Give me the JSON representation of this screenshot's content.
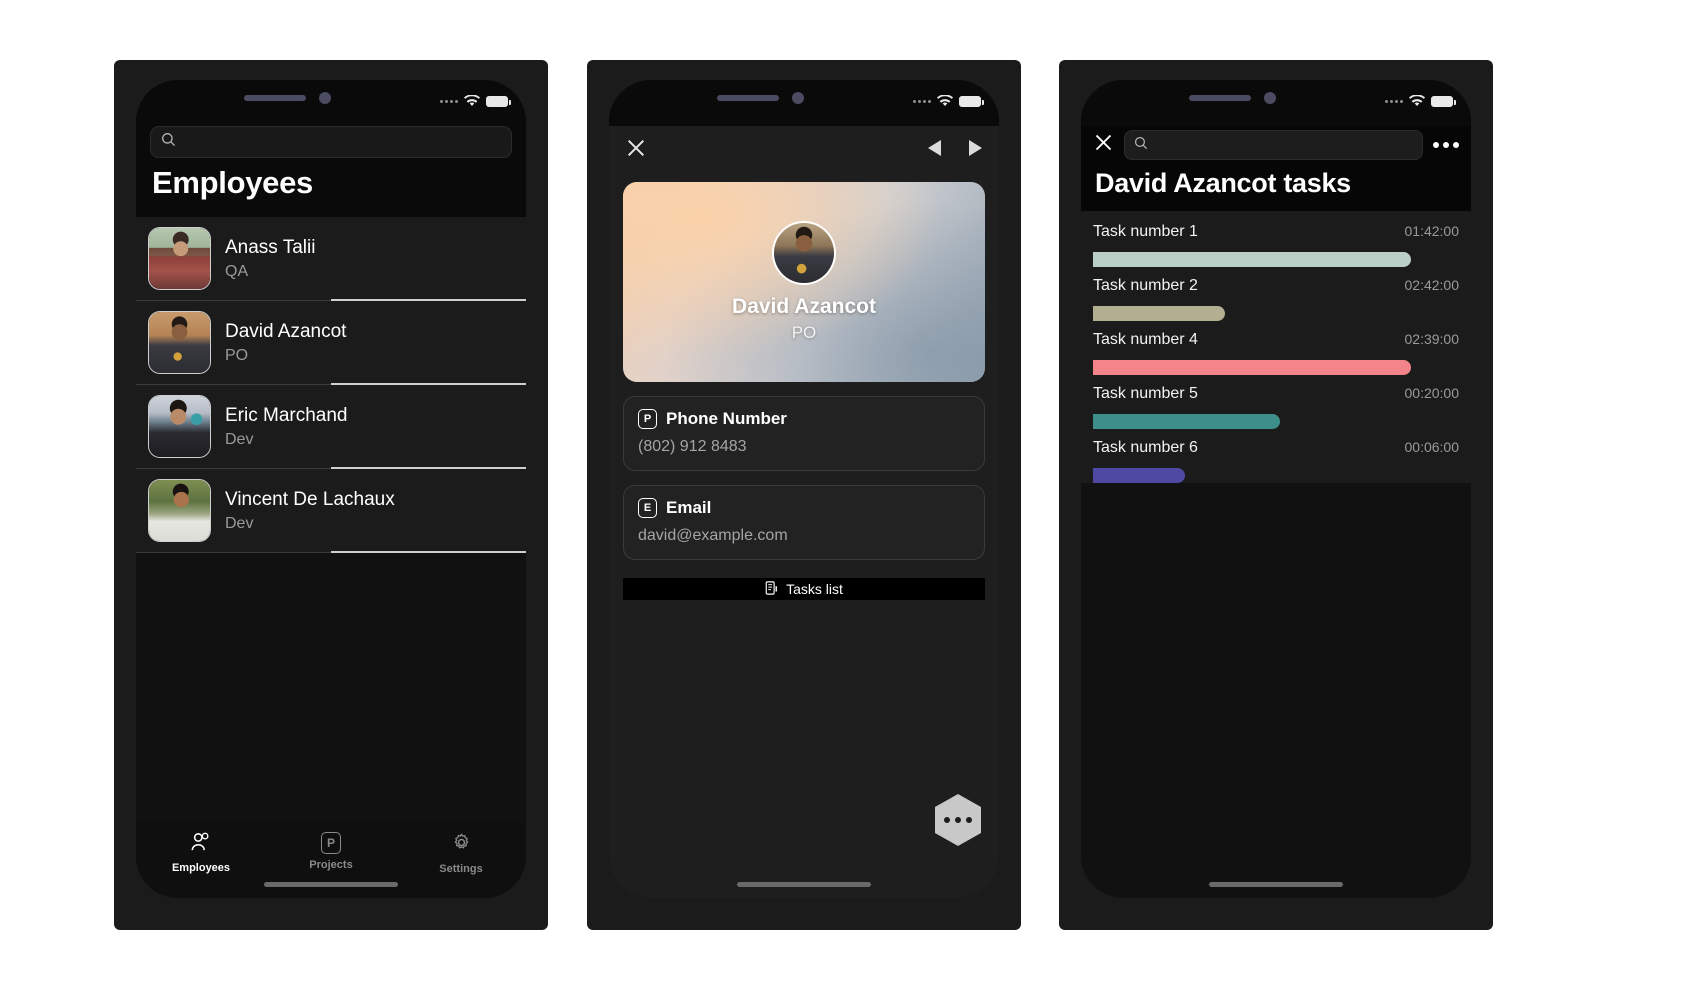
{
  "status_bar": {
    "signal_icon": "signal-dots-icon",
    "wifi_icon": "wifi-icon",
    "battery_icon": "battery-icon"
  },
  "phone1": {
    "search": {
      "placeholder": "",
      "value": "",
      "icon": "search-icon"
    },
    "title": "Employees",
    "employees": [
      {
        "name": "Anass Talii",
        "role": "QA"
      },
      {
        "name": "David Azancot",
        "role": "PO"
      },
      {
        "name": "Eric Marchand",
        "role": "Dev"
      },
      {
        "name": "Vincent De Lachaux",
        "role": "Dev"
      }
    ],
    "tabs": [
      {
        "label": "Employees",
        "icon": "people-icon",
        "active": true
      },
      {
        "label": "Projects",
        "icon": "p-box-icon",
        "active": false
      },
      {
        "label": "Settings",
        "icon": "gear-icon",
        "active": false
      }
    ]
  },
  "phone2": {
    "nav": {
      "close_icon": "close-icon",
      "prev_icon": "previous-arrow-icon",
      "next_icon": "next-arrow-icon"
    },
    "profile": {
      "name": "David Azancot",
      "role": "PO",
      "avatar": "profile-photo"
    },
    "info": [
      {
        "icon_letter": "P",
        "icon": "phone-letter-icon",
        "label": "Phone Number",
        "value": "(802) 912 8483"
      },
      {
        "icon_letter": "E",
        "icon": "email-letter-icon",
        "label": "Email",
        "value": "david@example.com"
      }
    ],
    "tasks_button": {
      "label": "Tasks list",
      "icon": "list-document-icon"
    },
    "fab": {
      "icon": "more-dots-icon"
    }
  },
  "phone3": {
    "nav": {
      "close_icon": "close-icon",
      "more_icon": "more-dots-icon"
    },
    "search": {
      "placeholder": "",
      "value": "",
      "icon": "search-icon"
    },
    "title": "David Azancot tasks",
    "tasks": [
      {
        "name": "Task number 1",
        "time": "01:42:00",
        "color": "#b9cfc7",
        "width_pct": 87
      },
      {
        "name": "Task number 2",
        "time": "02:42:00",
        "color": "#b2ae91",
        "width_pct": 36
      },
      {
        "name": "Task number 4",
        "time": "02:39:00",
        "color": "#f2848a",
        "width_pct": 87
      },
      {
        "name": "Task number 5",
        "time": "00:20:00",
        "color": "#3e8e8b",
        "width_pct": 51
      },
      {
        "name": "Task number 6",
        "time": "00:06:00",
        "color": "#4e4aa3",
        "width_pct": 25
      }
    ]
  }
}
